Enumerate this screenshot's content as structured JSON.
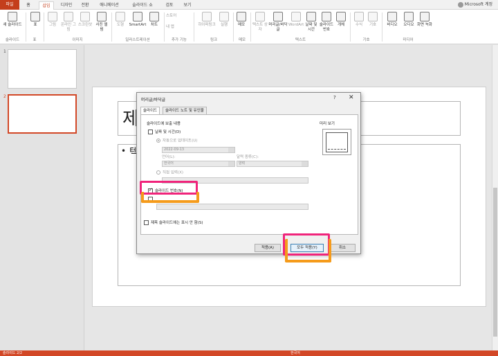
{
  "ribbon_tabs": [
    {
      "label": "파일"
    },
    {
      "label": "홈"
    },
    {
      "label": "삽입"
    },
    {
      "label": "디자인"
    },
    {
      "label": "전환"
    },
    {
      "label": "애니메이션"
    },
    {
      "label": "슬라이드 쇼"
    },
    {
      "label": "검토"
    },
    {
      "label": "보기"
    }
  ],
  "account": {
    "label": "Microsoft 계정"
  },
  "ribbon": {
    "buttons": [
      {
        "label": "새 슬라이드"
      },
      {
        "label": "표"
      },
      {
        "label": "그림"
      },
      {
        "label": "온라인 그림"
      },
      {
        "label": "스크린샷"
      },
      {
        "label": "사진 앨범"
      },
      {
        "label": "도형"
      },
      {
        "label": "SmartArt"
      },
      {
        "label": "차트"
      },
      {
        "label": "스토어"
      },
      {
        "label": "내 앱"
      },
      {
        "label": "하이퍼링크"
      },
      {
        "label": "실행"
      },
      {
        "label": "메모"
      },
      {
        "label": "텍스트 상자"
      },
      {
        "label": "머리글/바닥글"
      },
      {
        "label": "WordArt"
      },
      {
        "label": "날짜 및 시간"
      },
      {
        "label": "슬라이드 번호"
      },
      {
        "label": "개체"
      },
      {
        "label": "수식"
      },
      {
        "label": "기호"
      },
      {
        "label": "비디오"
      },
      {
        "label": "오디오"
      },
      {
        "label": "화면 녹화"
      }
    ],
    "groups": [
      "슬라이드",
      "표",
      "이미지",
      "일러스트레이션",
      "추가 기능",
      "링크",
      "메모",
      "텍스트",
      "기호",
      "미디어"
    ]
  },
  "thumbnails": [
    {
      "num": "1"
    },
    {
      "num": "2"
    }
  ],
  "slide": {
    "title": "제",
    "body": "텍"
  },
  "dialog": {
    "title": "머리글/바닥글",
    "help": "?",
    "close": "✕",
    "tabs": [
      "슬라이드",
      "슬라이드 노트 및 유인물"
    ],
    "group_title": "슬라이드에 보출 내용",
    "date_time": "날짜 및 시간(D)",
    "auto_update": "자동으로 업데이트(U)",
    "date_value": "2022-09-13",
    "language_label": "언어(L):",
    "language_value": "한국어",
    "calendar_label": "달력 종류(C):",
    "calendar_value": "양력",
    "fixed": "직접 입력(X)",
    "slide_number": "슬라이드 번호(N)",
    "dont_show_title": "제목 슬라이드에는 표시 안 함(S)",
    "preview_label": "미리 보기",
    "apply": "적용(A)",
    "apply_all": "모두 적용(Y)",
    "cancel": "취소"
  },
  "statusbar": {
    "left": "슬라이드 2/2",
    "language": "한국어"
  },
  "colors": {
    "accent": "#d24726",
    "highlight_pink": "#f0247b",
    "highlight_orange": "#f59b1b"
  }
}
